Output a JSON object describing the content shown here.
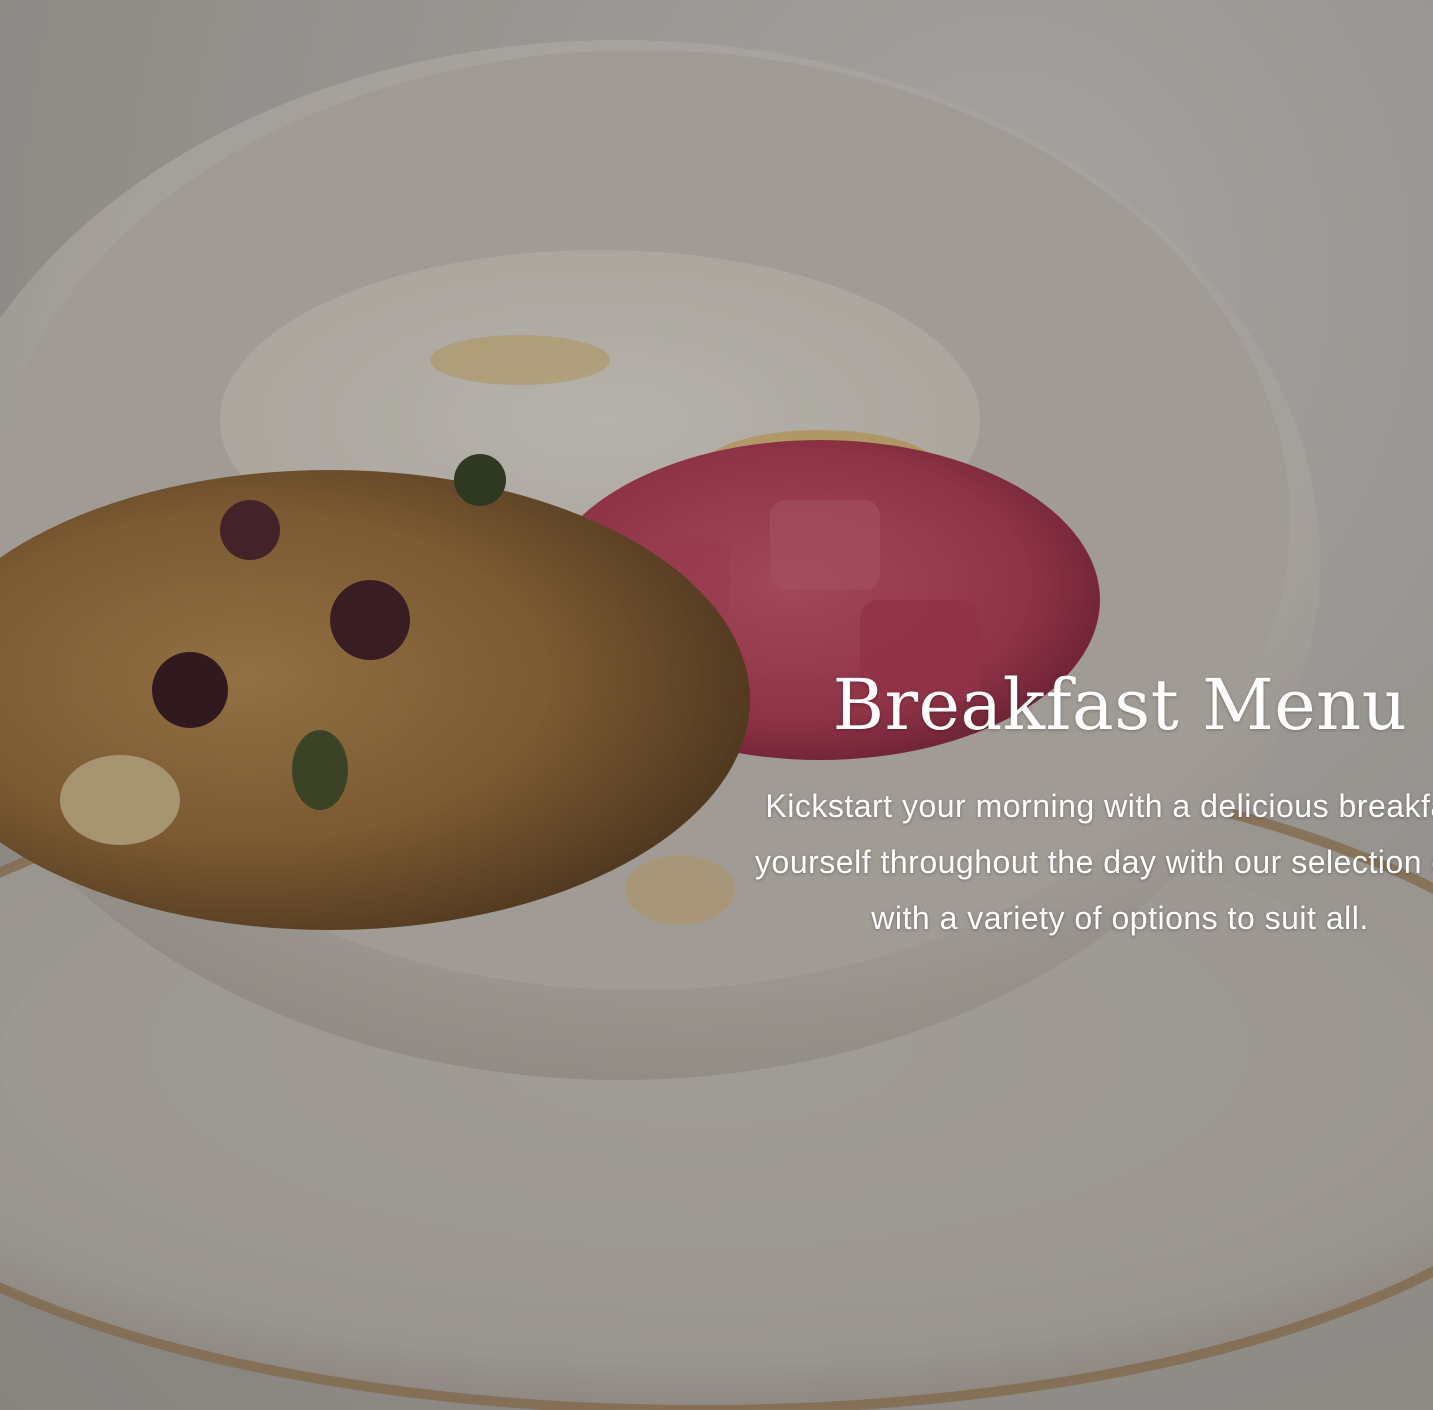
{
  "hero": {
    "title": "Breakfast Menu",
    "description_lines": [
      "Kickstart your morning with a delicious breakfast",
      "yourself throughout the day with our selection of s",
      "with a variety of options to suit all."
    ],
    "image_subject": "granola-yogurt-bowl-photo"
  },
  "colors": {
    "text": "#ffffff",
    "overlay": "#14100e"
  }
}
